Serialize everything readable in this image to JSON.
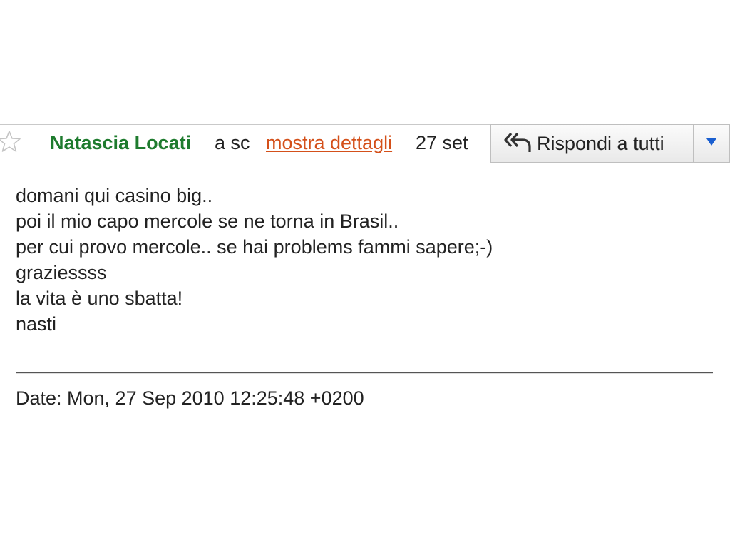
{
  "message_header": {
    "sender_name": "Natascia Locati",
    "recipients_truncated": "a sc",
    "show_details_link": "mostra dettagli",
    "date_short": "27 set",
    "reply_all_label": "Rispondi a tutti",
    "sender_color": "#1e7b2e",
    "link_color": "#d4501a",
    "icons": {
      "star": "star-icon",
      "reply_all": "reply-all-icon",
      "more": "chevron-down-icon"
    }
  },
  "message_body": {
    "lines": [
      "domani qui casino big..",
      "poi il mio capo mercole se ne torna in Brasil..",
      "per cui provo mercole.. se hai problems fammi sapere;-)",
      "graziessss",
      "la vita è uno sbatta!",
      "nasti"
    ]
  },
  "footer": {
    "date_line": "Date: Mon, 27 Sep 2010 12:25:48 +0200"
  }
}
